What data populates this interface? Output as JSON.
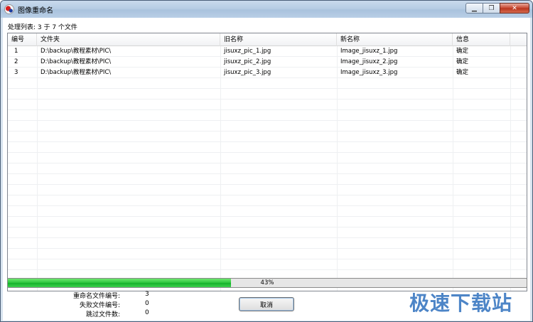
{
  "window": {
    "title": "图像重命名",
    "minimize_glyph": "▁",
    "restore_glyph": "❐",
    "close_glyph": "✕"
  },
  "list": {
    "caption": "处理列表: 3 于 7 个文件",
    "columns": [
      "编号",
      "文件夹",
      "旧名称",
      "新名称",
      "信息"
    ],
    "rows": [
      {
        "num": "1",
        "folder": "D:\\backup\\教程素材\\PIC\\",
        "old": "jisuxz_pic_1.jpg",
        "new": "Image_jisuxz_1.jpg",
        "info": "确定"
      },
      {
        "num": "2",
        "folder": "D:\\backup\\教程素材\\PIC\\",
        "old": "jisuxz_pic_2.jpg",
        "new": "Image_jisuxz_2.jpg",
        "info": "确定"
      },
      {
        "num": "3",
        "folder": "D:\\backup\\教程素材\\PIC\\",
        "old": "jisuxz_pic_3.jpg",
        "new": "Image_jisuxz_3.jpg",
        "info": "确定"
      }
    ]
  },
  "progress": {
    "text": "43%",
    "fraction": 0.43,
    "fill_color": "#28c43a"
  },
  "stats": [
    {
      "label": "重命名文件编号:",
      "value": "3"
    },
    {
      "label": "失败文件编号:",
      "value": "0"
    },
    {
      "label": "跳过文件数:",
      "value": "0"
    }
  ],
  "cancel_label": "取消",
  "watermark": "极速下载站"
}
